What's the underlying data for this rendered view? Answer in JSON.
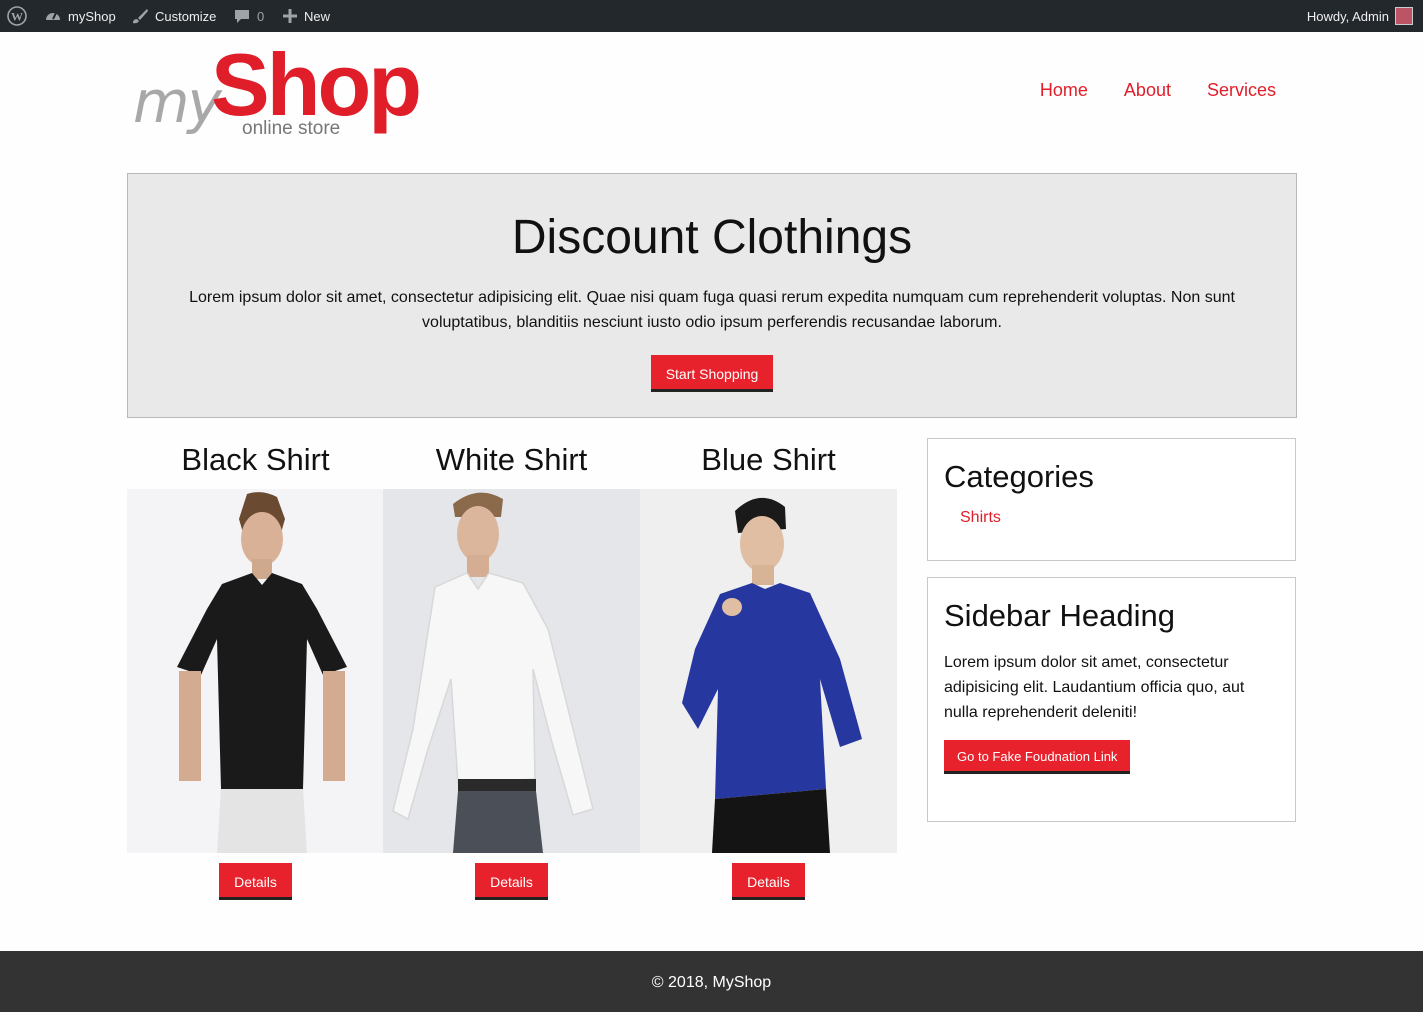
{
  "adminbar": {
    "site": "myShop",
    "customize": "Customize",
    "comments": "0",
    "new": "New",
    "howdy": "Howdy, Admin"
  },
  "logo": {
    "my": "my",
    "shop": "Shop",
    "tagline": "online store"
  },
  "nav": {
    "items": [
      "Home",
      "About",
      "Services"
    ]
  },
  "hero": {
    "title": "Discount Clothings",
    "text": "Lorem ipsum dolor sit amet, consectetur adipisicing elit. Quae nisi quam fuga quasi rerum expedita numquam cum reprehenderit voluptas. Non sunt voluptatibus, blanditiis nesciunt iusto odio ipsum perferendis recusandae laborum.",
    "button": "Start Shopping"
  },
  "products": [
    {
      "title": "Black Shirt",
      "button": "Details"
    },
    {
      "title": "White Shirt",
      "button": "Details"
    },
    {
      "title": "Blue Shirt",
      "button": "Details"
    }
  ],
  "sidebar": {
    "categories": {
      "heading": "Categories",
      "items": [
        "Shirts"
      ]
    },
    "widget": {
      "heading": "Sidebar Heading",
      "text": "Lorem ipsum dolor sit amet, consectetur adipisicing elit. Laudantium officia quo, aut nulla reprehenderit deleniti!",
      "button": "Go to Fake Foudnation Link"
    }
  },
  "footer": {
    "text": "© 2018, MyShop"
  },
  "colors": {
    "accent": "#e8222c",
    "adminbar": "#23282d",
    "footer": "#333333",
    "hero_bg": "#e9e9e9"
  }
}
